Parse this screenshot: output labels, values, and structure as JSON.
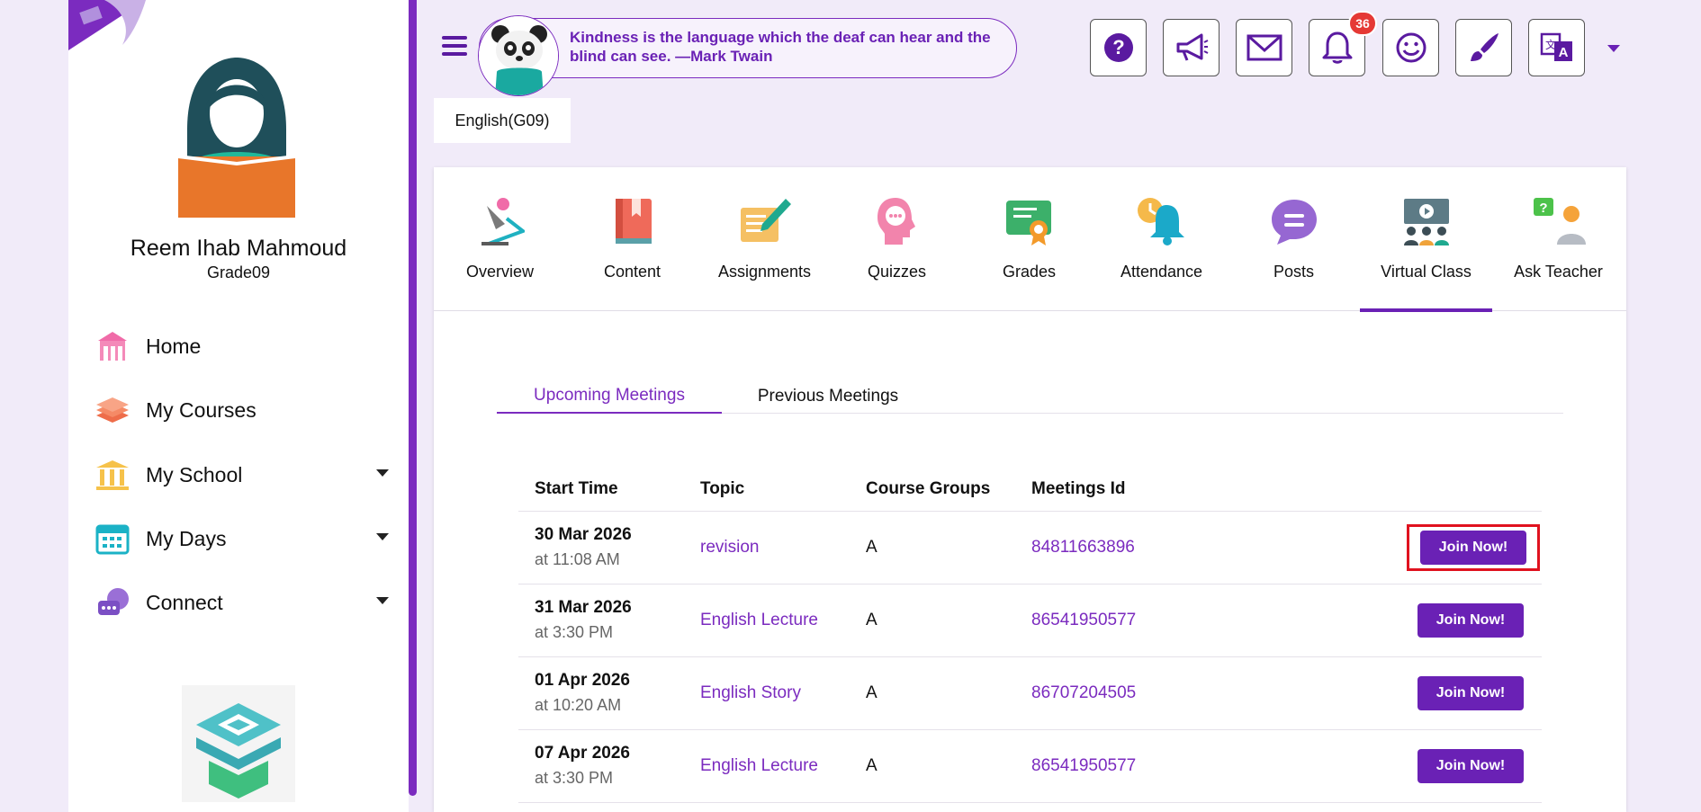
{
  "user": {
    "name": "Reem Ihab Mahmoud",
    "grade": "Grade09"
  },
  "sidebar": {
    "items": [
      {
        "label": "Home",
        "icon": "home-icon",
        "has_caret": false
      },
      {
        "label": "My Courses",
        "icon": "books-icon",
        "has_caret": false
      },
      {
        "label": "My School",
        "icon": "school-building-icon",
        "has_caret": true
      },
      {
        "label": "My Days",
        "icon": "calendar-icon",
        "has_caret": true
      },
      {
        "label": "Connect",
        "icon": "chat-icon",
        "has_caret": true
      }
    ]
  },
  "header": {
    "quote": "Kindness is the language which the deaf can hear and the blind can see. —Mark Twain",
    "icons": [
      "help-icon",
      "megaphone-icon",
      "mail-icon",
      "bell-icon",
      "smiley-icon",
      "brush-icon",
      "translate-icon"
    ],
    "notification_count": "36"
  },
  "course": {
    "label": "English(G09)"
  },
  "tabs": [
    {
      "label": "Overview",
      "icon": "desk-lamp-icon",
      "active": false
    },
    {
      "label": "Content",
      "icon": "book-icon",
      "active": false
    },
    {
      "label": "Assignments",
      "icon": "pen-paper-icon",
      "active": false
    },
    {
      "label": "Quizzes",
      "icon": "thinking-head-icon",
      "active": false
    },
    {
      "label": "Grades",
      "icon": "certificate-icon",
      "active": false
    },
    {
      "label": "Attendance",
      "icon": "clock-bell-icon",
      "active": false
    },
    {
      "label": "Posts",
      "icon": "speech-bubble-icon",
      "active": false
    },
    {
      "label": "Virtual Class",
      "icon": "virtual-class-icon",
      "active": true
    },
    {
      "label": "Ask Teacher",
      "icon": "question-person-icon",
      "active": false
    }
  ],
  "meetings": {
    "subtabs": [
      "Upcoming Meetings",
      "Previous Meetings"
    ],
    "active_subtab": "Upcoming Meetings",
    "headers": [
      "Start Time",
      "Topic",
      "Course Groups",
      "Meetings Id"
    ],
    "join_label": "Join Now!",
    "rows": [
      {
        "date": "30 Mar 2026",
        "time": "at 11:08 AM",
        "topic": "revision",
        "group": "A",
        "id": "84811663896",
        "highlighted": true
      },
      {
        "date": "31 Mar 2026",
        "time": "at 3:30 PM",
        "topic": "English Lecture",
        "group": "A",
        "id": "86541950577",
        "highlighted": false
      },
      {
        "date": "01 Apr 2026",
        "time": "at 10:20 AM",
        "topic": "English Story",
        "group": "A",
        "id": "86707204505",
        "highlighted": false
      },
      {
        "date": "07 Apr 2026",
        "time": "at 3:30 PM",
        "topic": "English Lecture",
        "group": "A",
        "id": "86541950577",
        "highlighted": false
      }
    ]
  },
  "colors": {
    "accent": "#6a21b5",
    "link": "#7b2bbf",
    "highlight": "#e0121f",
    "badge": "#e53935",
    "page_bg": "#f1ebf9"
  }
}
